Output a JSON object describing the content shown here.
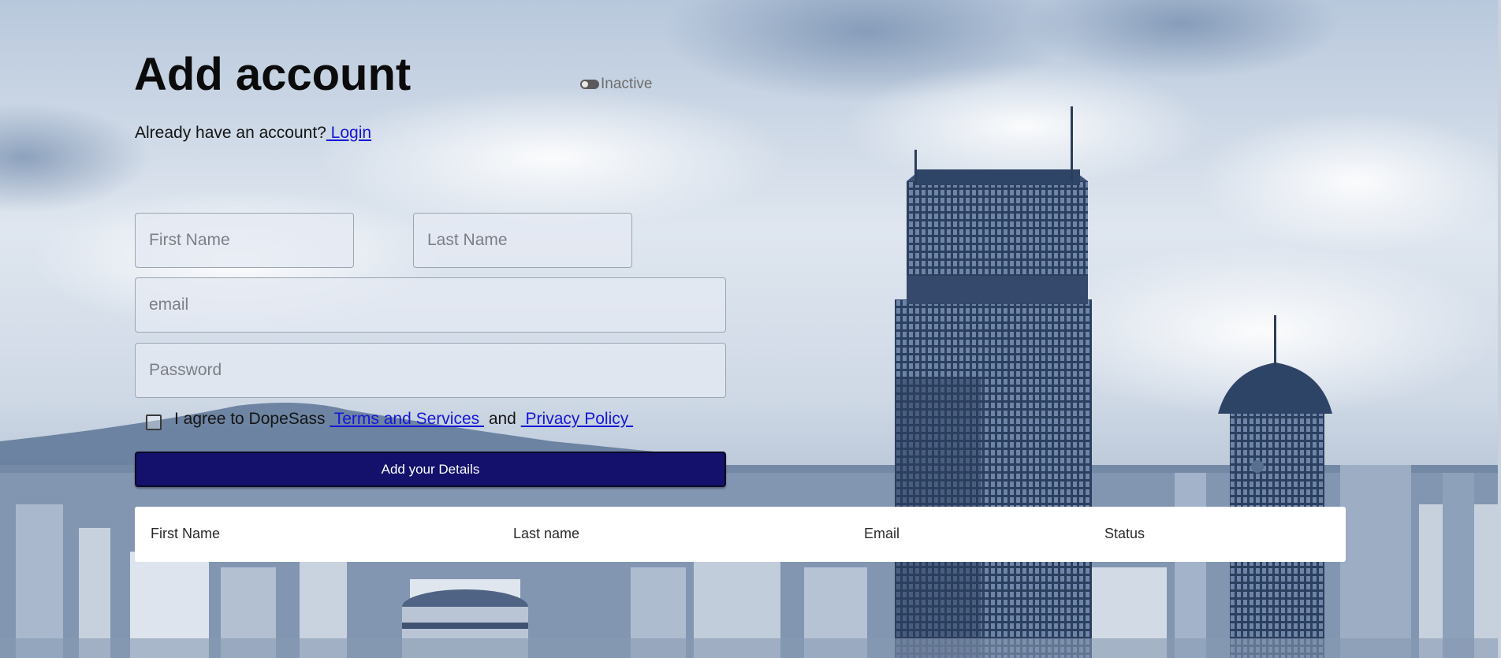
{
  "form": {
    "title": "Add account",
    "status_label": "Inactive",
    "login_prompt": "Already have an account?",
    "login_link": " Login",
    "first_name_placeholder": "First Name",
    "last_name_placeholder": "Last Name",
    "email_placeholder": "email",
    "password_placeholder": "Password",
    "agree_prefix": "I agree to DopeSass ",
    "terms_link": " Terms and Services ",
    "agree_and": " and ",
    "privacy_link": " Privacy Policy ",
    "agree_checked": false,
    "status_active": false,
    "submit_label": "Add your Details"
  },
  "table": {
    "headers": [
      "First Name",
      "Last name",
      "Email",
      "Status"
    ]
  },
  "colors": {
    "button_bg": "#13116b",
    "link": "#1616d6"
  }
}
